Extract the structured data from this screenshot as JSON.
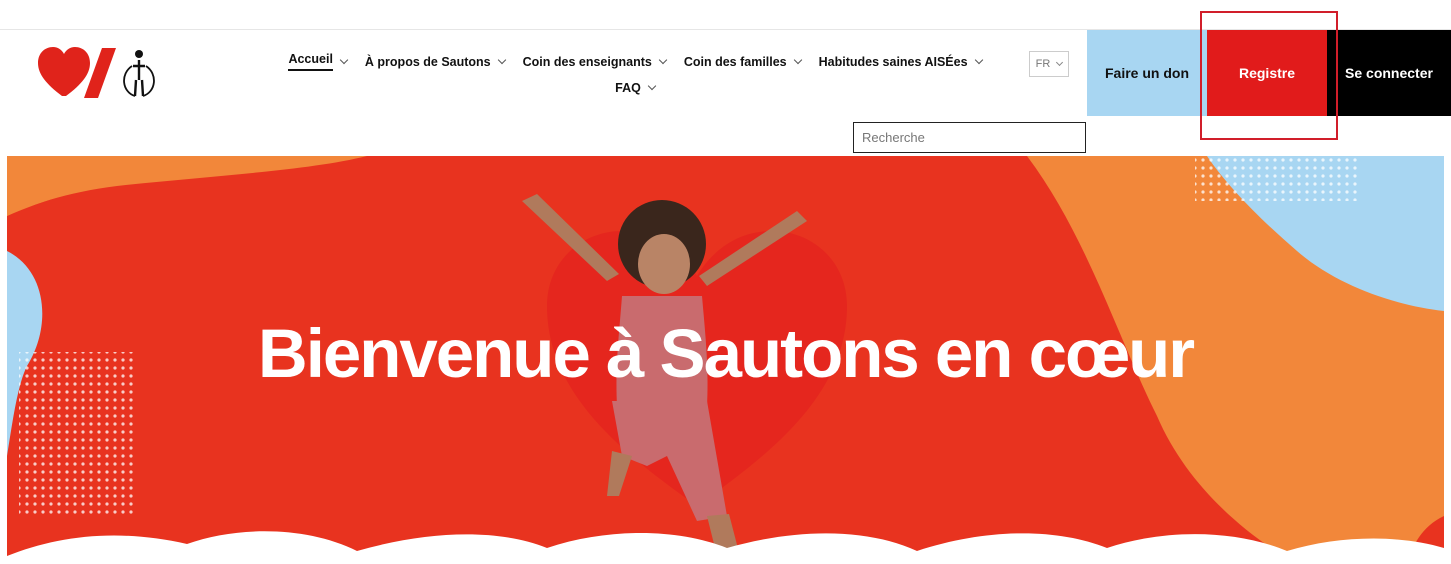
{
  "header": {
    "logo_alt": "Heart & Stroke Jump Rope logo",
    "nav": [
      {
        "label": "Accueil",
        "active": true
      },
      {
        "label": "À propos de Sautons"
      },
      {
        "label": "Coin des enseignants"
      },
      {
        "label": "Coin des familles"
      },
      {
        "label": "Habitudes saines AISÉes"
      },
      {
        "label": "FAQ"
      }
    ],
    "language": "FR",
    "donate_label": "Faire un don",
    "register_label": "Registre",
    "login_label": "Se connecter",
    "search_placeholder": "Recherche"
  },
  "hero": {
    "title": "Bienvenue à Sautons en cœur"
  },
  "colors": {
    "brand_red": "#e11b1b",
    "donate_blue": "#a8d6f2",
    "hero_orange": "#f2873a",
    "highlight_red": "#d11e2a"
  },
  "icons": [
    "heart-logo-icon",
    "slash-logo-icon",
    "jump-rope-person-icon",
    "chevron-down-icon"
  ]
}
